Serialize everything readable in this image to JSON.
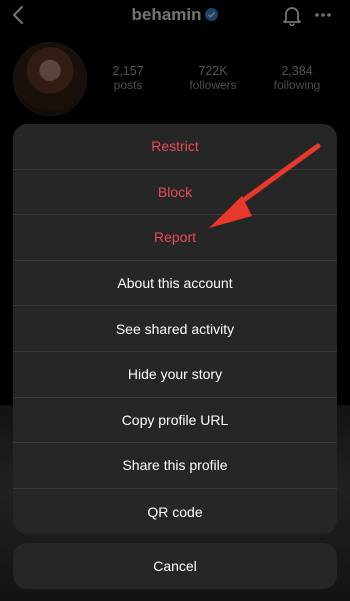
{
  "header": {
    "username": "behamin"
  },
  "stats": [
    {
      "count": "2,157",
      "label": "posts"
    },
    {
      "count": "722K",
      "label": "followers"
    },
    {
      "count": "2,384",
      "label": "following"
    }
  ],
  "menu": {
    "items": [
      {
        "label": "Restrict",
        "style": "danger"
      },
      {
        "label": "Block",
        "style": "danger"
      },
      {
        "label": "Report",
        "style": "danger"
      },
      {
        "label": "About this account",
        "style": "normal"
      },
      {
        "label": "See shared activity",
        "style": "normal"
      },
      {
        "label": "Hide your story",
        "style": "normal"
      },
      {
        "label": "Copy profile URL",
        "style": "normal"
      },
      {
        "label": "Share this profile",
        "style": "normal"
      },
      {
        "label": "QR code",
        "style": "normal"
      }
    ],
    "cancel_label": "Cancel"
  },
  "colors": {
    "danger": "#ed4956",
    "sheet": "#262626",
    "verified": "#3897f0",
    "arrow": "#e8382c"
  },
  "icons": [
    "back-chevron-icon",
    "verified-badge-icon",
    "bell-icon",
    "more-dots-icon"
  ]
}
